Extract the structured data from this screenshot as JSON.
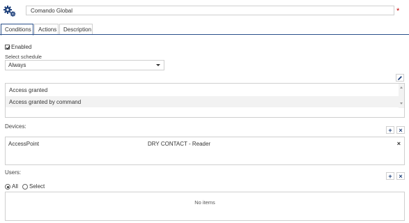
{
  "header": {
    "name_value": "Comando Global",
    "required_mark": "*"
  },
  "tabs": [
    {
      "label": "Conditions",
      "active": true
    },
    {
      "label": "Actions",
      "active": false
    },
    {
      "label": "Description",
      "active": false
    }
  ],
  "conditions": {
    "enabled_label": "Enabled",
    "enabled_checked": true,
    "schedule_label": "Select schedule",
    "schedule_value": "Always",
    "access_options": [
      "Access granted",
      "Access granted by command"
    ],
    "selected_access_option": "Access granted by command"
  },
  "devices": {
    "label": "Devices:",
    "add_symbol": "+",
    "remove_symbol": "×",
    "rows": [
      {
        "name": "AccessPoint",
        "type": "DRY CONTACT - Reader",
        "delete_symbol": "×"
      }
    ]
  },
  "users": {
    "label": "Users:",
    "add_symbol": "+",
    "remove_symbol": "×",
    "all_label": "All",
    "select_label": "Select",
    "selected_mode": "All",
    "empty_text": "No items"
  },
  "colors": {
    "accent": "#2a4f8a",
    "required": "#c00000",
    "border": "#cfcfcf",
    "selected_row": "#f2f2f2"
  },
  "icons": {
    "header": "gears-icon",
    "edit": "pencil-icon",
    "add": "plus-icon",
    "remove": "close-icon"
  }
}
